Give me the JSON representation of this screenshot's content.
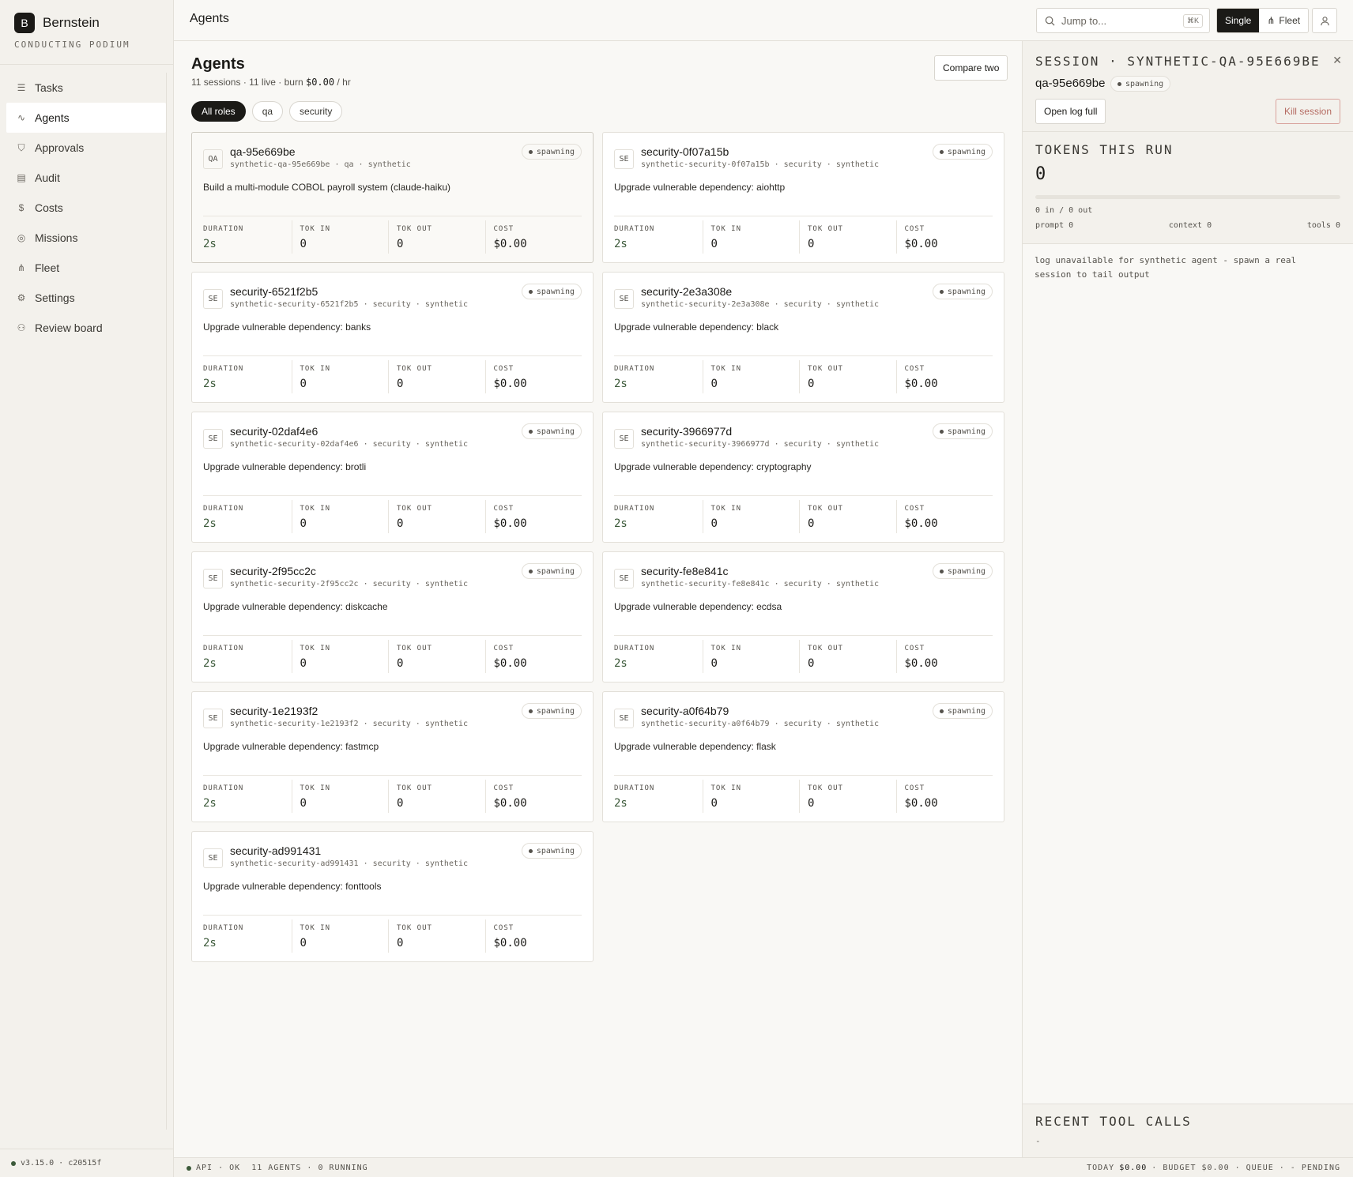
{
  "brand": {
    "logo": "B",
    "name": "Bernstein",
    "subtitle": "CONDUCTING PODIUM"
  },
  "nav": [
    {
      "label": "Tasks",
      "icon": "list-check-icon",
      "glyph": "☰",
      "active": false
    },
    {
      "label": "Agents",
      "icon": "activity-icon",
      "glyph": "∿",
      "active": true
    },
    {
      "label": "Approvals",
      "icon": "shield-icon",
      "glyph": "⛉",
      "active": false
    },
    {
      "label": "Audit",
      "icon": "clipboard-icon",
      "glyph": "▤",
      "active": false
    },
    {
      "label": "Costs",
      "icon": "dollar-icon",
      "glyph": "$",
      "active": false
    },
    {
      "label": "Missions",
      "icon": "target-icon",
      "glyph": "◎",
      "active": false
    },
    {
      "label": "Fleet",
      "icon": "network-icon",
      "glyph": "⋔",
      "active": false
    },
    {
      "label": "Settings",
      "icon": "gear-icon",
      "glyph": "⚙",
      "active": false
    },
    {
      "label": "Review board",
      "icon": "users-icon",
      "glyph": "⚇",
      "active": false
    }
  ],
  "version": "v3.15.0 · c20515f",
  "topbar": {
    "title": "Agents",
    "search_placeholder": "Jump to...",
    "search_shortcut": "⌘K",
    "mode_single": "Single",
    "mode_fleet": "Fleet",
    "mode_active": "Single"
  },
  "page": {
    "title": "Agents",
    "summary_prefix": "11 sessions · 11 live · burn ",
    "summary_burn": "$0.00",
    "summary_suffix": " / hr",
    "compare_label": "Compare two"
  },
  "filters": [
    {
      "label": "All roles",
      "active": true
    },
    {
      "label": "qa",
      "active": false
    },
    {
      "label": "security",
      "active": false
    }
  ],
  "stat_labels": {
    "duration": "DURATION",
    "tok_in": "TOK IN",
    "tok_out": "TOK OUT",
    "cost": "COST"
  },
  "agents": [
    {
      "role": "QA",
      "name": "qa-95e669be",
      "meta": "synthetic-qa-95e669be · qa · synthetic",
      "status": "spawning",
      "task": "Build a multi-module COBOL payroll system (claude-haiku)",
      "duration": "2s",
      "tok_in": "0",
      "tok_out": "0",
      "cost": "$0.00",
      "selected": true
    },
    {
      "role": "SE",
      "name": "security-0f07a15b",
      "meta": "synthetic-security-0f07a15b · security · synthetic",
      "status": "spawning",
      "task": "Upgrade vulnerable dependency: aiohttp",
      "duration": "2s",
      "tok_in": "0",
      "tok_out": "0",
      "cost": "$0.00",
      "selected": false
    },
    {
      "role": "SE",
      "name": "security-6521f2b5",
      "meta": "synthetic-security-6521f2b5 · security · synthetic",
      "status": "spawning",
      "task": "Upgrade vulnerable dependency: banks",
      "duration": "2s",
      "tok_in": "0",
      "tok_out": "0",
      "cost": "$0.00",
      "selected": false
    },
    {
      "role": "SE",
      "name": "security-2e3a308e",
      "meta": "synthetic-security-2e3a308e · security · synthetic",
      "status": "spawning",
      "task": "Upgrade vulnerable dependency: black",
      "duration": "2s",
      "tok_in": "0",
      "tok_out": "0",
      "cost": "$0.00",
      "selected": false
    },
    {
      "role": "SE",
      "name": "security-02daf4e6",
      "meta": "synthetic-security-02daf4e6 · security · synthetic",
      "status": "spawning",
      "task": "Upgrade vulnerable dependency: brotli",
      "duration": "2s",
      "tok_in": "0",
      "tok_out": "0",
      "cost": "$0.00",
      "selected": false
    },
    {
      "role": "SE",
      "name": "security-3966977d",
      "meta": "synthetic-security-3966977d · security · synthetic",
      "status": "spawning",
      "task": "Upgrade vulnerable dependency: cryptography",
      "duration": "2s",
      "tok_in": "0",
      "tok_out": "0",
      "cost": "$0.00",
      "selected": false
    },
    {
      "role": "SE",
      "name": "security-2f95cc2c",
      "meta": "synthetic-security-2f95cc2c · security · synthetic",
      "status": "spawning",
      "task": "Upgrade vulnerable dependency: diskcache",
      "duration": "2s",
      "tok_in": "0",
      "tok_out": "0",
      "cost": "$0.00",
      "selected": false
    },
    {
      "role": "SE",
      "name": "security-fe8e841c",
      "meta": "synthetic-security-fe8e841c · security · synthetic",
      "status": "spawning",
      "task": "Upgrade vulnerable dependency: ecdsa",
      "duration": "2s",
      "tok_in": "0",
      "tok_out": "0",
      "cost": "$0.00",
      "selected": false
    },
    {
      "role": "SE",
      "name": "security-1e2193f2",
      "meta": "synthetic-security-1e2193f2 · security · synthetic",
      "status": "spawning",
      "task": "Upgrade vulnerable dependency: fastmcp",
      "duration": "2s",
      "tok_in": "0",
      "tok_out": "0",
      "cost": "$0.00",
      "selected": false
    },
    {
      "role": "SE",
      "name": "security-a0f64b79",
      "meta": "synthetic-security-a0f64b79 · security · synthetic",
      "status": "spawning",
      "task": "Upgrade vulnerable dependency: flask",
      "duration": "2s",
      "tok_in": "0",
      "tok_out": "0",
      "cost": "$0.00",
      "selected": false
    },
    {
      "role": "SE",
      "name": "security-ad991431",
      "meta": "synthetic-security-ad991431 · security · synthetic",
      "status": "spawning",
      "task": "Upgrade vulnerable dependency: fonttools",
      "duration": "2s",
      "tok_in": "0",
      "tok_out": "0",
      "cost": "$0.00",
      "selected": false
    }
  ],
  "panel": {
    "header": "SESSION · SYNTHETIC-QA-95E669BE",
    "name": "qa-95e669be",
    "status": "spawning",
    "open_log": "Open log full",
    "kill": "Kill session",
    "tokens_title": "TOKENS THIS RUN",
    "tokens_value": "0",
    "token_progress": 0,
    "in_out": "0 in / 0 out",
    "prompt": "prompt 0",
    "context": "context 0",
    "tools": "tools 0",
    "log_text": "log unavailable for synthetic agent - spawn a real session to tail output",
    "recent_title": "RECENT TOOL CALLS",
    "recent_value": "-"
  },
  "statusbar": {
    "left": "API · OK  11 AGENTS · 0 RUNNING",
    "today_label": "TODAY",
    "today_value": "$0.00",
    "budget": "· BUDGET $0.00 · QUEUE · - PENDING"
  },
  "colors": {
    "accent": "#3c5a3a",
    "ink": "#1b1a17",
    "kill": "#b56b62"
  }
}
